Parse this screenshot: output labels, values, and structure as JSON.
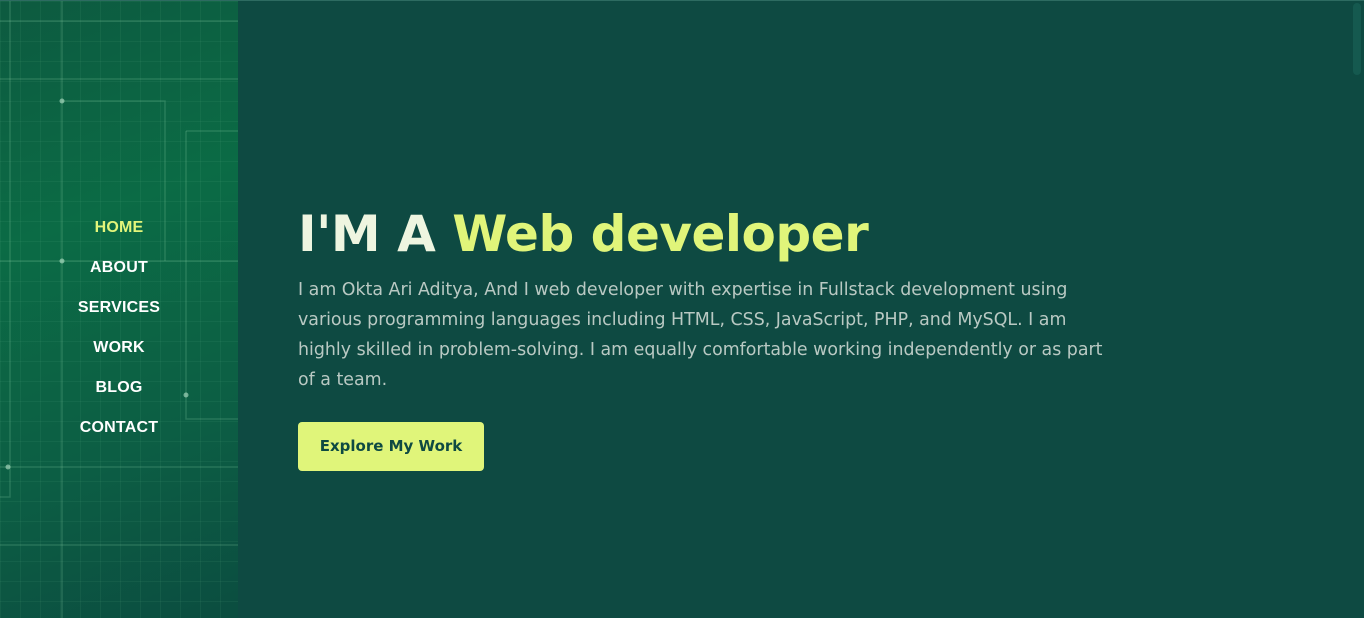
{
  "nav": {
    "items": [
      {
        "label": "HOME",
        "active": true
      },
      {
        "label": "ABOUT",
        "active": false
      },
      {
        "label": "SERVICES",
        "active": false
      },
      {
        "label": "WORK",
        "active": false
      },
      {
        "label": "BLOG",
        "active": false
      },
      {
        "label": "CONTACT",
        "active": false
      }
    ]
  },
  "hero": {
    "headline_prefix": "I'M A ",
    "headline_accent": "Web developer",
    "intro": "I am Okta Ari Aditya, And I web developer with expertise in Fullstack development using various programming languages including HTML, CSS, JavaScript, PHP, and MySQL. I am highly skilled in problem-solving. I am equally comfortable working independently or as part of a team.",
    "cta_label": "Explore My Work"
  },
  "colors": {
    "background": "#0e4a42",
    "accent": "#e0f57a",
    "sidebar": "#0b6b45",
    "body_text": "#b9c9c3"
  }
}
